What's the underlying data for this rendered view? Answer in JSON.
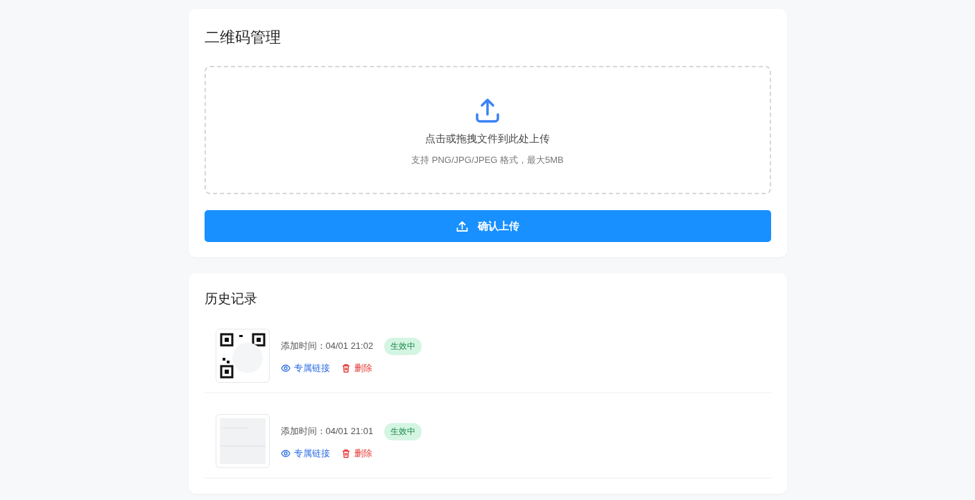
{
  "upload_card": {
    "title": "二维码管理",
    "dropzone": {
      "prompt": "点击或拖拽文件到此处上传",
      "hint": "支持 PNG/JPG/JPEG 格式，最大5MB"
    },
    "confirm_button": "确认上传"
  },
  "history": {
    "title": "历史记录",
    "items": [
      {
        "kind": "qr",
        "time": "添加时间：04/01 21:02",
        "status": {
          "label": "生效中",
          "kind": "active"
        },
        "link": "专属链接",
        "delete": "删除"
      },
      {
        "kind": "blank",
        "time": "添加时间：04/01 21:01",
        "status": {
          "label": "生效中",
          "kind": "active"
        },
        "link": "专属链接",
        "delete": "删除"
      }
    ]
  }
}
